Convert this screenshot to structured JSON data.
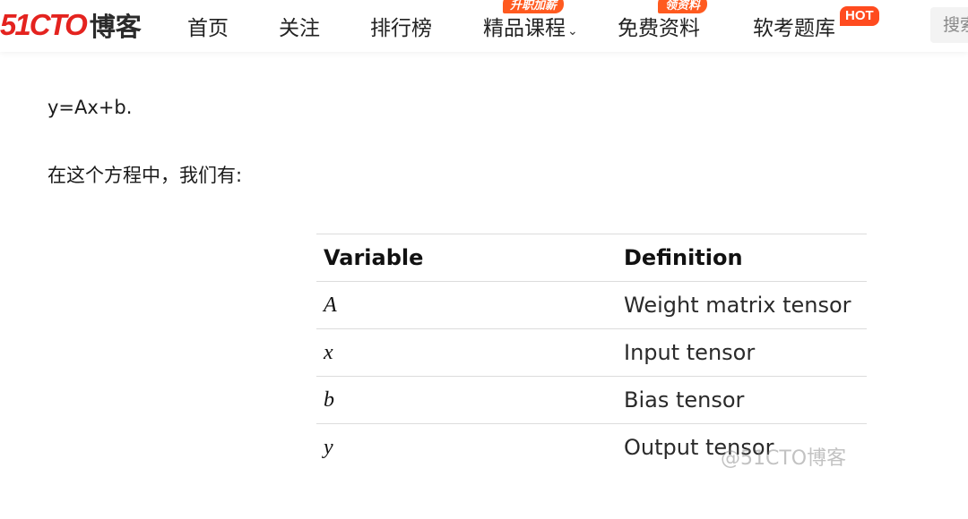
{
  "header": {
    "logo_primary": "51CTO",
    "logo_secondary": "博客",
    "nav": [
      {
        "label": "首页"
      },
      {
        "label": "关注"
      },
      {
        "label": "排行榜"
      },
      {
        "label": "精品课程",
        "badge": "升职加薪",
        "has_dropdown": true
      },
      {
        "label": "免费资料",
        "badge": "领资料"
      },
      {
        "label": "软考题库",
        "badge": "HOT"
      }
    ],
    "search_placeholder": "搜索"
  },
  "content": {
    "equation_line": "y=Ax+b.",
    "intro_line": "在这个方程中，我们有:",
    "table": {
      "headers": [
        "Variable",
        "Definition"
      ],
      "rows": [
        {
          "variable": "A",
          "definition": "Weight matrix tensor"
        },
        {
          "variable": "x",
          "definition": "Input tensor"
        },
        {
          "variable": "b",
          "definition": "Bias tensor"
        },
        {
          "variable": "y",
          "definition": "Output tensor"
        }
      ]
    },
    "watermark": "@51CTO博客"
  },
  "colors": {
    "brand_red": "#e4231f",
    "badge_orange": "#ff5a1f"
  }
}
